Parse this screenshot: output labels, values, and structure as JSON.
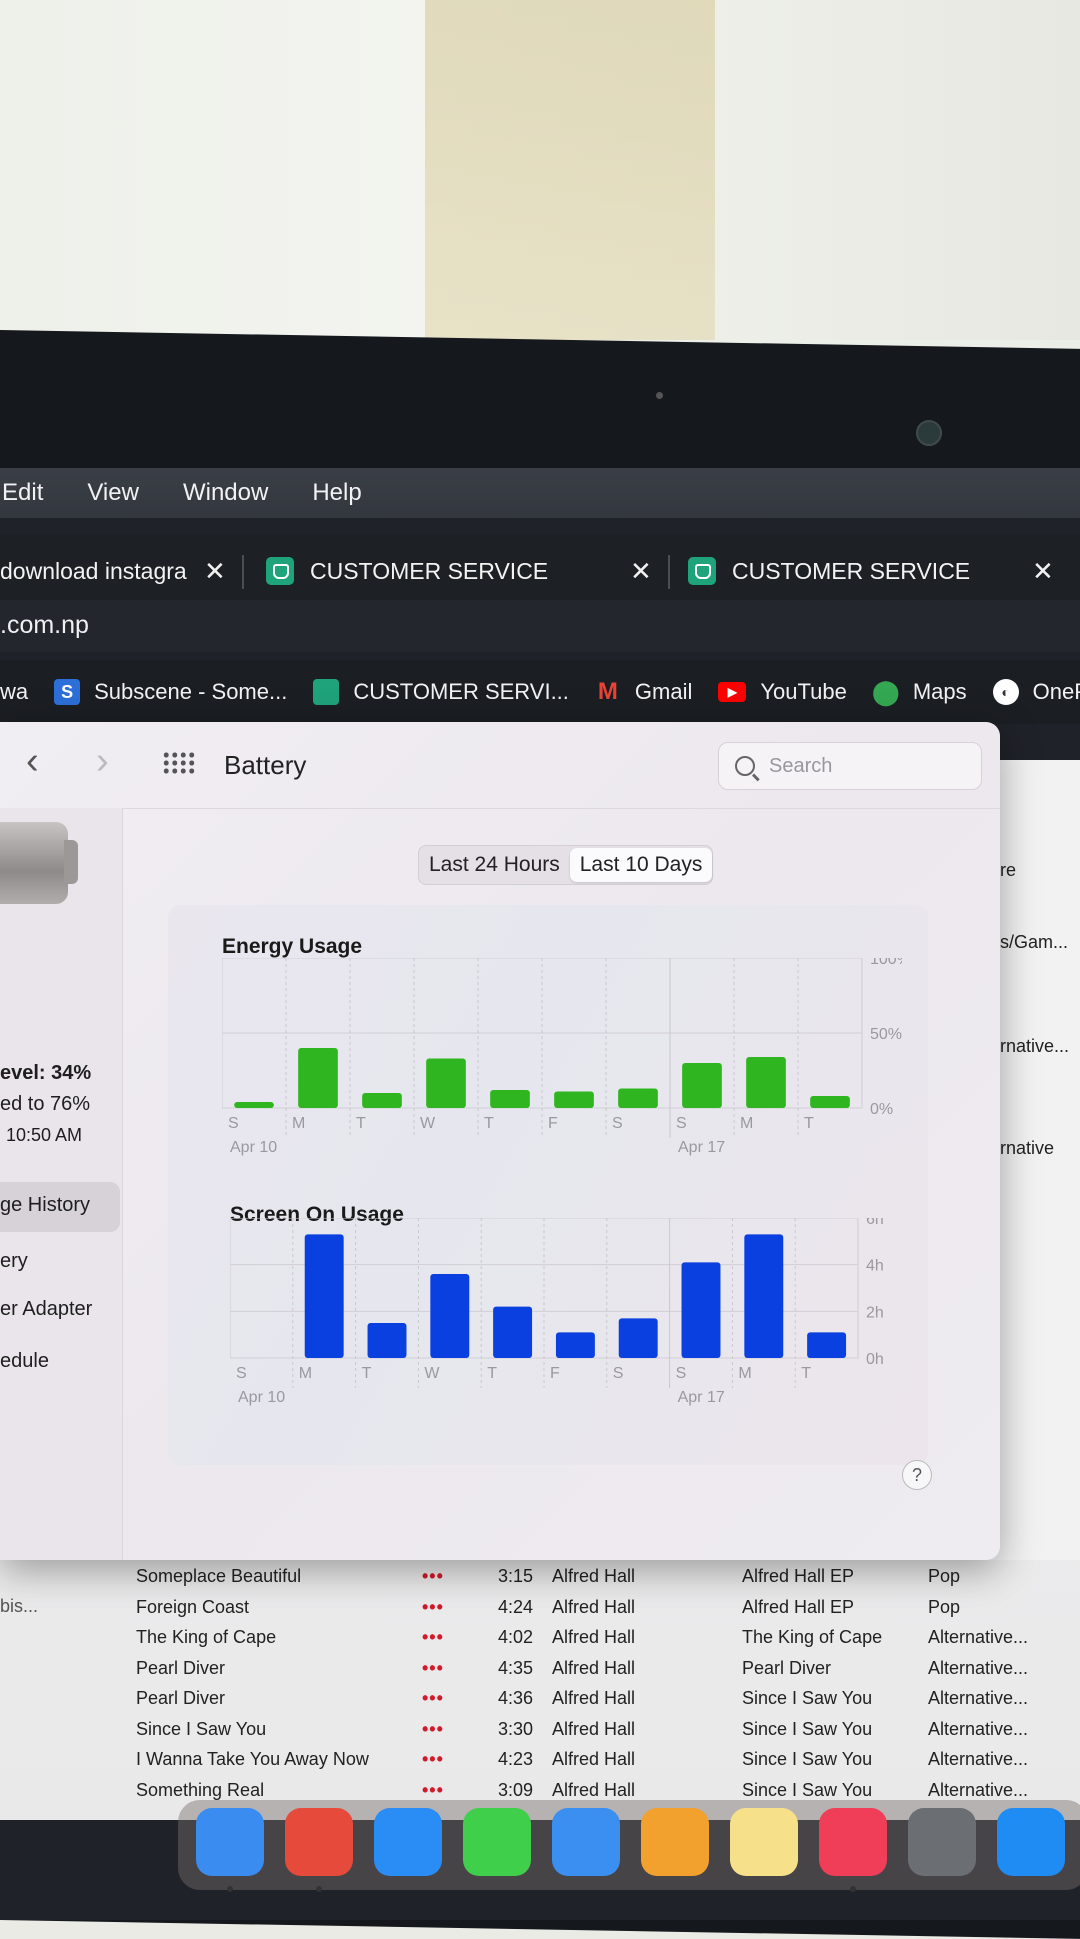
{
  "menubar": {
    "items": [
      "Edit",
      "View",
      "Window",
      "Help"
    ]
  },
  "tabs": [
    {
      "label": "download instagra",
      "close": "✕"
    },
    {
      "label": "CUSTOMER SERVICE",
      "close": "✕"
    },
    {
      "label": "CUSTOMER SERVICE",
      "close": "✕"
    }
  ],
  "url": ".com.np",
  "bookmarks": [
    "wa",
    "Subscene - Some...",
    "CUSTOMER SERVI...",
    "Gmail",
    "YouTube",
    "Maps",
    "OnePl"
  ],
  "window": {
    "title": "Battery",
    "search_placeholder": "Search",
    "segments": [
      "Last 24 Hours",
      "Last 10 Days"
    ],
    "selected_segment": "Last 10 Days",
    "sidebar": {
      "level": "evel: 34%",
      "charged": "ed to 76%",
      "time": "10:50 AM",
      "items": [
        "ge History",
        "ery",
        "er Adapter",
        "edule"
      ],
      "selected": "ge History"
    },
    "help": "?"
  },
  "chart_data": [
    {
      "type": "bar",
      "title": "Energy Usage",
      "categories": [
        "S",
        "M",
        "T",
        "W",
        "T",
        "F",
        "S",
        "S",
        "M",
        "T"
      ],
      "values": [
        4,
        40,
        10,
        33,
        12,
        11,
        13,
        30,
        34,
        8
      ],
      "yticks": [
        "100%",
        "50%",
        "0%"
      ],
      "ylim": [
        0,
        100
      ],
      "date_labels": [
        "Apr 10",
        "Apr 17"
      ],
      "color": "#2fb51f"
    },
    {
      "type": "bar",
      "title": "Screen On Usage",
      "categories": [
        "S",
        "M",
        "T",
        "W",
        "T",
        "F",
        "S",
        "S",
        "M",
        "T"
      ],
      "values": [
        0,
        5.3,
        1.5,
        3.6,
        2.2,
        1.1,
        1.7,
        4.1,
        5.3,
        1.1
      ],
      "yticks": [
        "6h",
        "4h",
        "2h",
        "0h"
      ],
      "ylim": [
        0,
        6
      ],
      "date_labels": [
        "Apr 10",
        "Apr 17"
      ],
      "color": "#0a3fe0"
    }
  ],
  "music": {
    "genres_right": [
      "nre",
      "ns/Gam...",
      "ernative...",
      "ernative"
    ],
    "rows": [
      {
        "title": "Someplace Beautiful",
        "time": "3:15",
        "artist": "Alfred Hall",
        "album": "Alfred Hall EP",
        "genre": "Pop"
      },
      {
        "title": "Foreign Coast",
        "time": "4:24",
        "artist": "Alfred Hall",
        "album": "Alfred Hall EP",
        "genre": "Pop"
      },
      {
        "title": "The King of Cape",
        "time": "4:02",
        "artist": "Alfred Hall",
        "album": "The King of Cape",
        "genre": "Alternative..."
      },
      {
        "title": "Pearl Diver",
        "time": "4:35",
        "artist": "Alfred Hall",
        "album": "Pearl Diver",
        "genre": "Alternative..."
      },
      {
        "title": "Pearl Diver",
        "time": "4:36",
        "artist": "Alfred Hall",
        "album": "Since I Saw You",
        "genre": "Alternative..."
      },
      {
        "title": "Since I Saw You",
        "time": "3:30",
        "artist": "Alfred Hall",
        "album": "Since I Saw You",
        "genre": "Alternative..."
      },
      {
        "title": "I Wanna Take You Away Now",
        "time": "4:23",
        "artist": "Alfred Hall",
        "album": "Since I Saw You",
        "genre": "Alternative..."
      },
      {
        "title": "Something Real",
        "time": "3:09",
        "artist": "Alfred Hall",
        "album": "Since I Saw You",
        "genre": "Alternative..."
      }
    ],
    "left_fragments": [
      "bis..."
    ],
    "dots": "•••"
  },
  "dock": {
    "apps": [
      "finder-icon",
      "chrome-icon",
      "safari-icon",
      "messages-icon",
      "mail-icon",
      "photos-icon",
      "notes-icon",
      "music-icon",
      "system-settings-icon",
      "app-store-icon"
    ],
    "colors": [
      "#3b8cf0",
      "#e64a3b",
      "#2a8df5",
      "#3fcf4b",
      "#3a8ff0",
      "#f2a12e",
      "#f7e08a",
      "#f03d58",
      "#6b6e73",
      "#1f8cf3"
    ]
  }
}
